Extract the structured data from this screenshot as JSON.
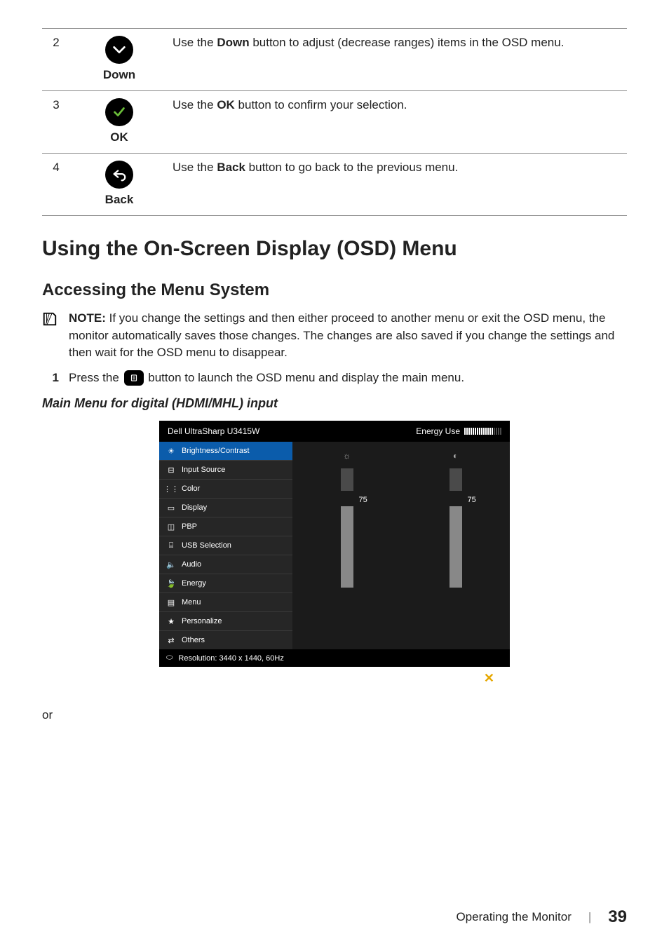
{
  "button_table": [
    {
      "num": "2",
      "label": "Down",
      "desc_pre": "Use the ",
      "desc_bold": "Down",
      "desc_post": " button to adjust (decrease ranges) items in the OSD menu."
    },
    {
      "num": "3",
      "label": "OK",
      "desc_pre": "Use the ",
      "desc_bold": "OK",
      "desc_post": " button to confirm your selection."
    },
    {
      "num": "4",
      "label": "Back",
      "desc_pre": "Use the ",
      "desc_bold": "Back",
      "desc_post": " button to go back to the previous menu."
    }
  ],
  "section_title": "Using the On-Screen Display (OSD) Menu",
  "subsection_title": "Accessing the Menu System",
  "note": {
    "bold": "NOTE:",
    "text": " If you change the settings and then either proceed to another menu or exit the OSD menu, the monitor automatically saves those changes. The changes are also saved if you change the settings and then wait for the OSD menu to disappear."
  },
  "step1": {
    "num": "1",
    "pre": "Press the ",
    "post": " button to launch the OSD menu and display the main menu."
  },
  "menu_caption": "Main Menu for digital (HDMI/MHL) input",
  "osd": {
    "title": "Dell UltraSharp U3415W",
    "energy_label": "Energy Use",
    "menu": [
      "Brightness/Contrast",
      "Input Source",
      "Color",
      "Display",
      "PBP",
      "USB Selection",
      "Audio",
      "Energy",
      "Menu",
      "Personalize",
      "Others"
    ],
    "brightness_value": "75",
    "contrast_value": "75",
    "resolution": "Resolution: 3440 x 1440, 60Hz"
  },
  "or_text": "or",
  "footer": {
    "section": "Operating the Monitor",
    "sep": "|",
    "page": "39"
  }
}
